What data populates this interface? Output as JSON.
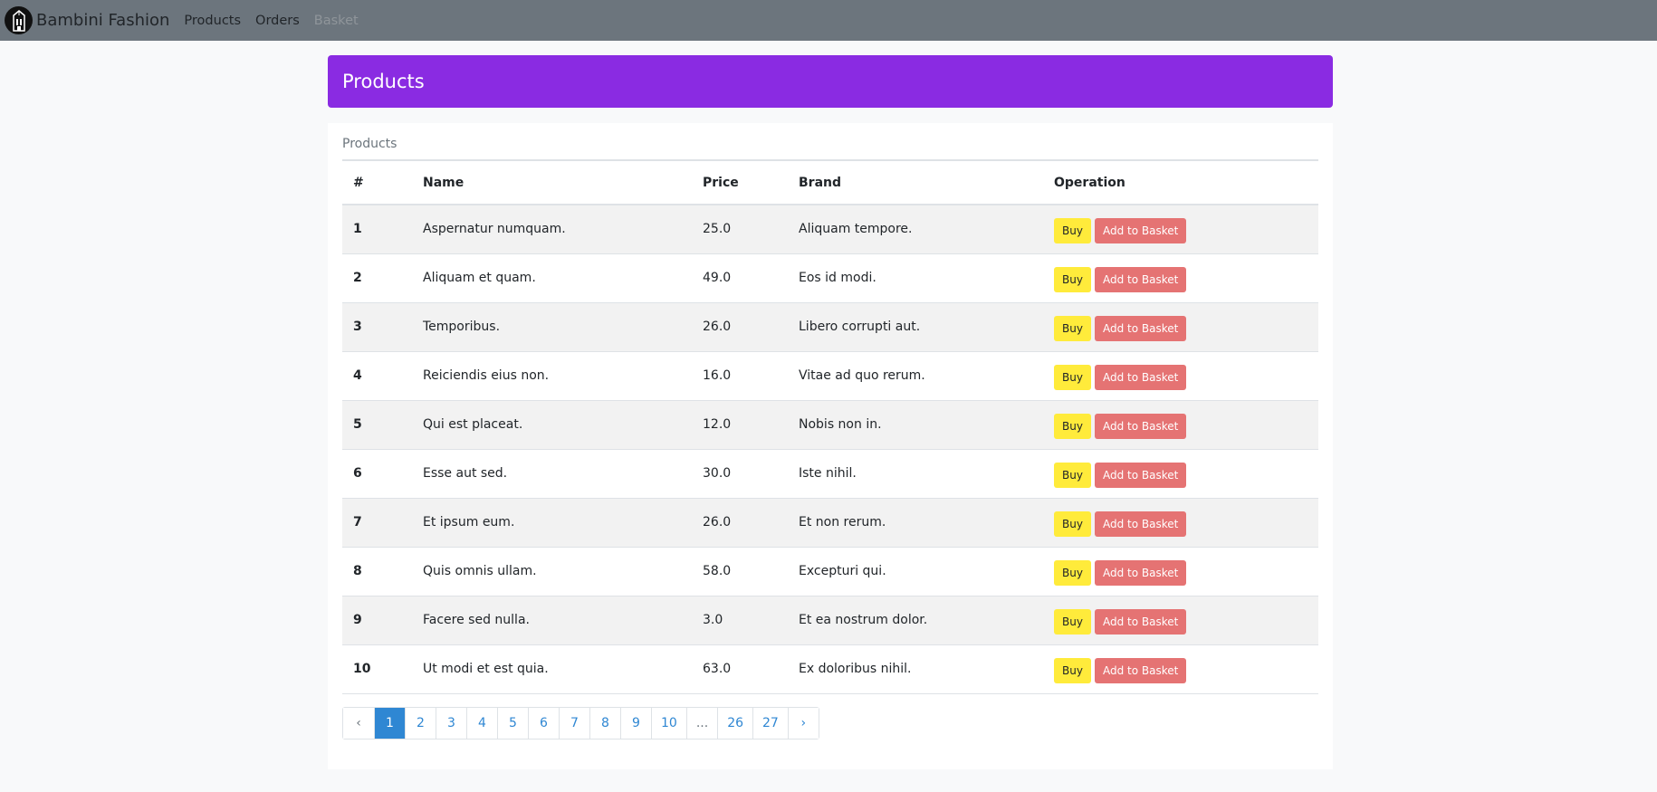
{
  "navbar": {
    "brand": "Bambini Fashion",
    "logo_icon": "building-logo-icon",
    "links": [
      {
        "label": "Products",
        "disabled": false
      },
      {
        "label": "Orders",
        "disabled": false
      },
      {
        "label": "Basket",
        "disabled": true
      }
    ]
  },
  "header": {
    "title": "Products"
  },
  "card": {
    "caption": "Products"
  },
  "table": {
    "columns": [
      "#",
      "Name",
      "Price",
      "Brand",
      "Operation"
    ],
    "rows": [
      {
        "num": "1",
        "name": "Aspernatur numquam.",
        "price": "25.0",
        "brand": "Aliquam tempore."
      },
      {
        "num": "2",
        "name": "Aliquam et quam.",
        "price": "49.0",
        "brand": "Eos id modi."
      },
      {
        "num": "3",
        "name": "Temporibus.",
        "price": "26.0",
        "brand": "Libero corrupti aut."
      },
      {
        "num": "4",
        "name": "Reiciendis eius non.",
        "price": "16.0",
        "brand": "Vitae ad quo rerum."
      },
      {
        "num": "5",
        "name": "Qui est placeat.",
        "price": "12.0",
        "brand": "Nobis non in."
      },
      {
        "num": "6",
        "name": "Esse aut sed.",
        "price": "30.0",
        "brand": "Iste nihil."
      },
      {
        "num": "7",
        "name": "Et ipsum eum.",
        "price": "26.0",
        "brand": "Et non rerum."
      },
      {
        "num": "8",
        "name": "Quis omnis ullam.",
        "price": "58.0",
        "brand": "Excepturi qui."
      },
      {
        "num": "9",
        "name": "Facere sed nulla.",
        "price": "3.0",
        "brand": "Et ea nostrum dolor."
      },
      {
        "num": "10",
        "name": "Ut modi et est quia.",
        "price": "63.0",
        "brand": "Ex doloribus nihil."
      }
    ],
    "buy_label": "Buy",
    "basket_label": "Add to Basket"
  },
  "pagination": {
    "prev": "‹",
    "next": "›",
    "pages": [
      "1",
      "2",
      "3",
      "4",
      "5",
      "6",
      "7",
      "8",
      "9",
      "10",
      "...",
      "26",
      "27"
    ],
    "active": "1"
  },
  "colors": {
    "navbar": "#6c757d",
    "banner": "#8a2be2",
    "buy": "#ffeb3b",
    "basket": "#e57373",
    "link": "#2f87d3"
  }
}
